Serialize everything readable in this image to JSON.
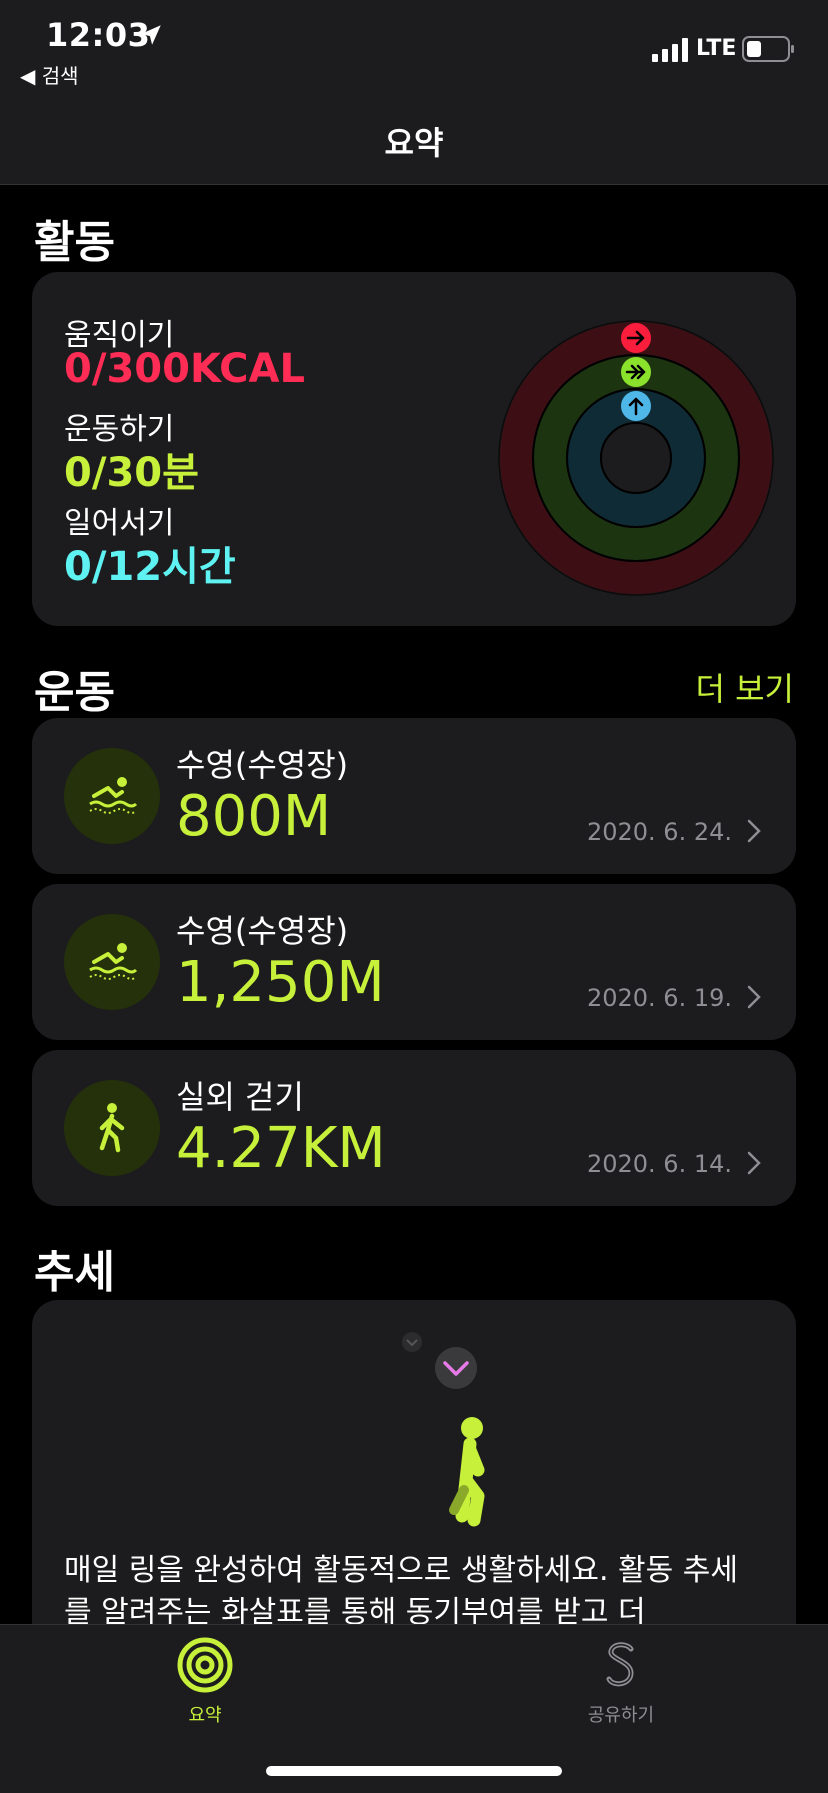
{
  "status": {
    "time": "12:03",
    "back_label": "◀ 검색",
    "network": "LTE"
  },
  "nav": {
    "title": "요약"
  },
  "activity": {
    "section_title": "활동",
    "move": {
      "label": "움직이기",
      "value": "0/300KCAL",
      "color": "#ff2d55"
    },
    "exercise": {
      "label": "운동하기",
      "value": "0/30분",
      "color": "#c7f03a"
    },
    "stand": {
      "label": "일어서기",
      "value": "0/12시간",
      "color": "#5ef2f2"
    }
  },
  "workouts": {
    "section_title": "운동",
    "more_label": "더 보기",
    "items": [
      {
        "name": "수영(수영장)",
        "value": "800M",
        "date": "2020. 6. 24.",
        "icon": "swimming-icon"
      },
      {
        "name": "수영(수영장)",
        "value": "1,250M",
        "date": "2020. 6. 19.",
        "icon": "swimming-icon"
      },
      {
        "name": "실외 걷기",
        "value": "4.27KM",
        "date": "2020. 6. 14.",
        "icon": "walking-icon"
      }
    ]
  },
  "trends": {
    "section_title": "추세",
    "description": "매일 링을 완성하여 활동적으로 생활하세요. 활동 추세를 알려주는 화살표를 통해 동기부여를 받고 더"
  },
  "tabbar": {
    "items": [
      {
        "label": "요약",
        "active": true
      },
      {
        "label": "공유하기",
        "active": false
      }
    ]
  },
  "colors": {
    "accent": "#c7f03a",
    "background": "#000000",
    "card": "#1c1c1e"
  }
}
